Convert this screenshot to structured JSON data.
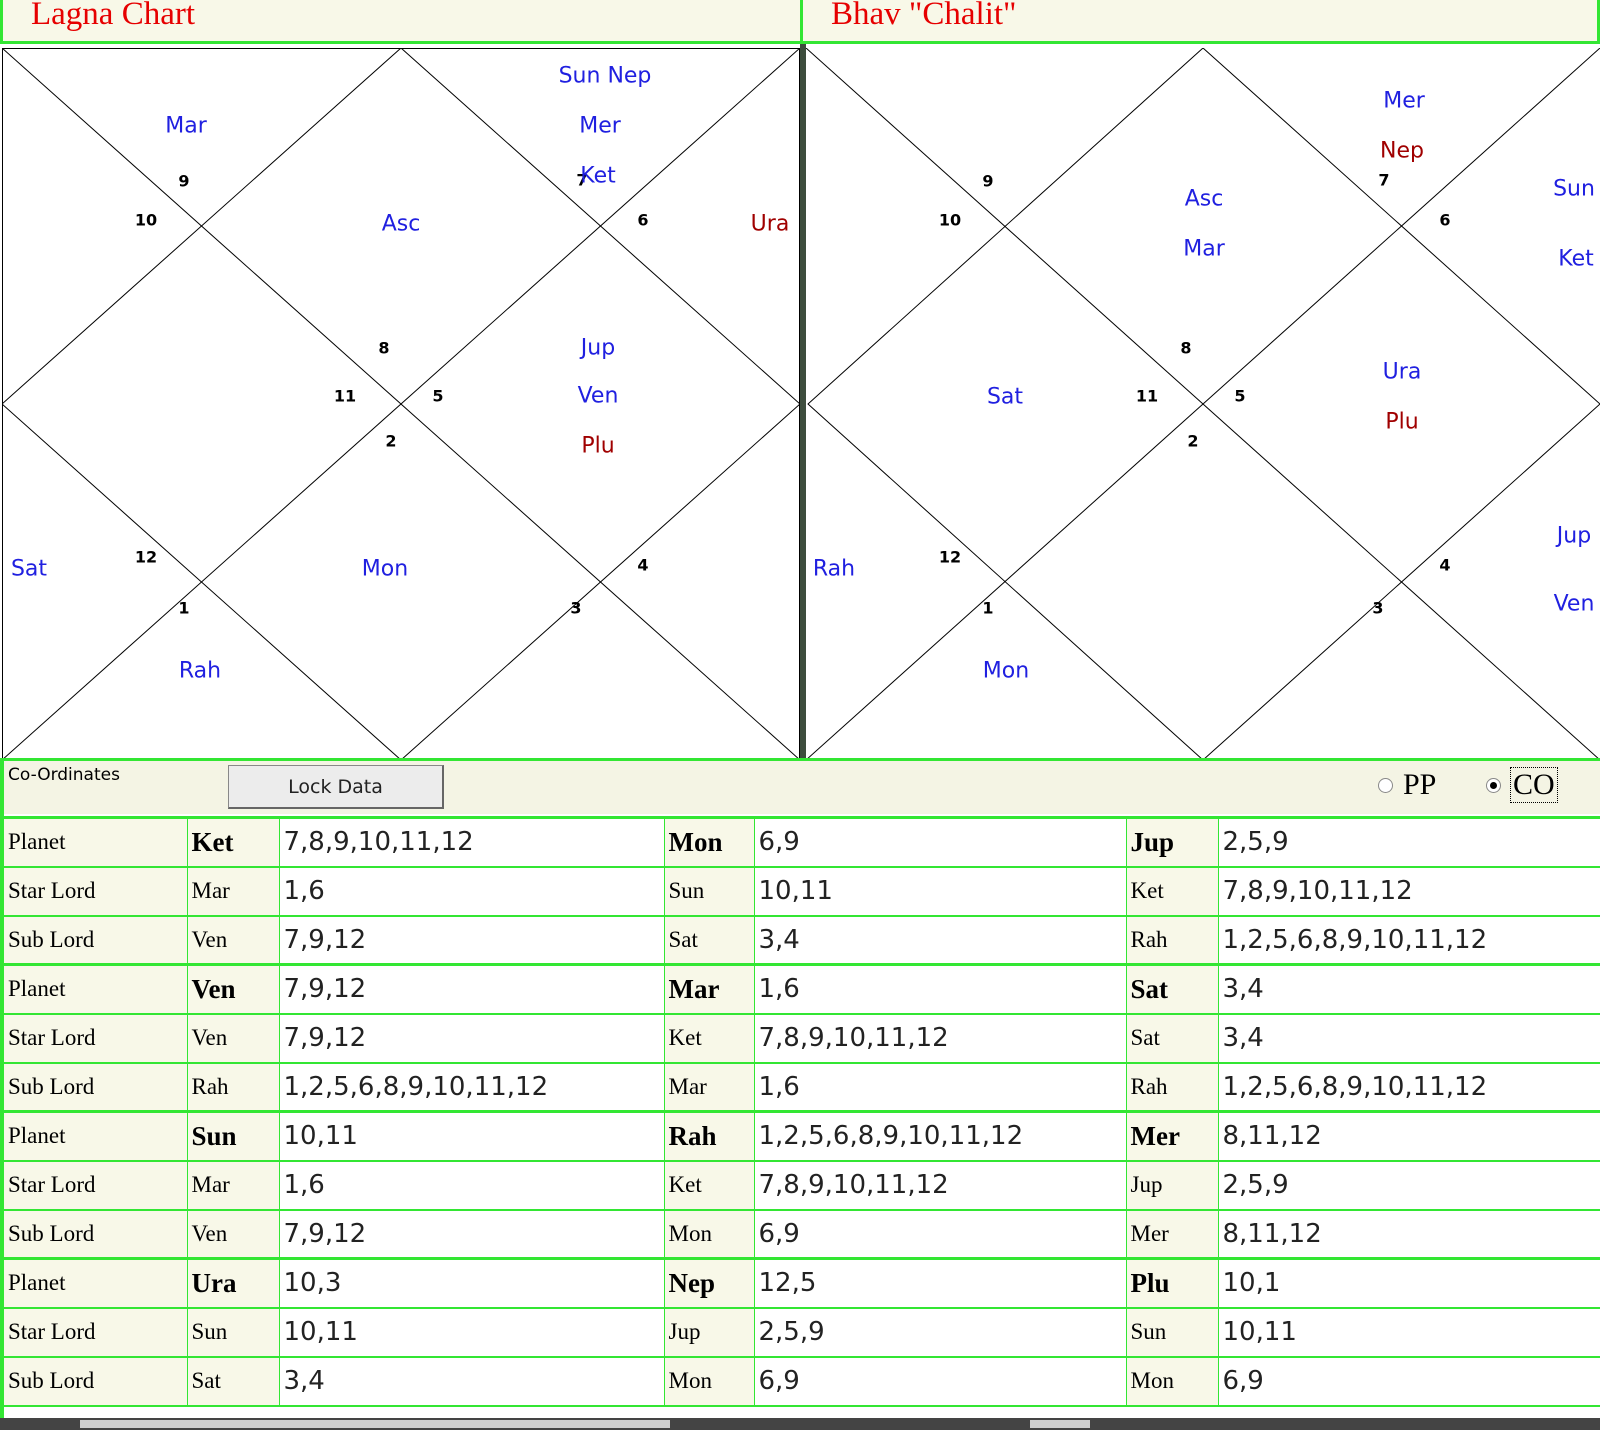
{
  "lagna": {
    "title": "Lagna Chart",
    "house_numbers": [
      "1",
      "2",
      "3",
      "4",
      "5",
      "6",
      "7",
      "8",
      "9",
      "10",
      "11",
      "12"
    ],
    "planets": [
      {
        "label": "Sun Nep",
        "color": "#2020e0"
      },
      {
        "label": "Mer",
        "color": "#2020e0"
      },
      {
        "label": "Ket",
        "color": "#2020e0"
      },
      {
        "label": "Mar",
        "color": "#2020e0"
      },
      {
        "label": "Asc",
        "color": "#2020e0"
      },
      {
        "label": "Ura",
        "color": "#a00000"
      },
      {
        "label": "Jup",
        "color": "#2020e0"
      },
      {
        "label": "Ven",
        "color": "#2020e0"
      },
      {
        "label": "Plu",
        "color": "#a00000"
      },
      {
        "label": "Sat",
        "color": "#2020e0"
      },
      {
        "label": "Mon",
        "color": "#2020e0"
      },
      {
        "label": "Rah",
        "color": "#2020e0"
      }
    ]
  },
  "chalit": {
    "title": "Bhav \"Chalit\"",
    "house_numbers": [
      "1",
      "2",
      "3",
      "4",
      "5",
      "6",
      "7",
      "8",
      "9",
      "10",
      "11",
      "12"
    ],
    "planets": [
      {
        "label": "Mer",
        "color": "#2020e0"
      },
      {
        "label": "Nep",
        "color": "#a00000"
      },
      {
        "label": "Asc",
        "color": "#2020e0"
      },
      {
        "label": "Mar",
        "color": "#2020e0"
      },
      {
        "label": "Sun",
        "color": "#2020e0"
      },
      {
        "label": "Ket",
        "color": "#2020e0"
      },
      {
        "label": "Sat",
        "color": "#2020e0"
      },
      {
        "label": "Ura",
        "color": "#2020e0"
      },
      {
        "label": "Plu",
        "color": "#a00000"
      },
      {
        "label": "Rah",
        "color": "#2020e0"
      },
      {
        "label": "Mon",
        "color": "#2020e0"
      },
      {
        "label": "Jup",
        "color": "#2020e0"
      },
      {
        "label": "Ven",
        "color": "#2020e0"
      }
    ]
  },
  "toolbar": {
    "coord_label": "Co-Ordinates",
    "lock_label": "Lock Data",
    "radio_pp": "PP",
    "radio_co": "CO",
    "selected": "CO"
  },
  "grid": {
    "row_labels": [
      "Planet",
      "Star Lord",
      "Sub Lord"
    ],
    "groups": [
      [
        {
          "planet": "Ket",
          "planet_val": "7,8,9,10,11,12",
          "star": "Mar",
          "star_val": "1,6",
          "sub": "Ven",
          "sub_val": "7,9,12"
        },
        {
          "planet": "Mon",
          "planet_val": "6,9",
          "star": "Sun",
          "star_val": "10,11",
          "sub": "Sat",
          "sub_val": "3,4"
        },
        {
          "planet": "Jup",
          "planet_val": "2,5,9",
          "star": "Ket",
          "star_val": "7,8,9,10,11,12",
          "sub": "Rah",
          "sub_val": "1,2,5,6,8,9,10,11,12"
        }
      ],
      [
        {
          "planet": "Ven",
          "planet_val": "7,9,12",
          "star": "Ven",
          "star_val": "7,9,12",
          "sub": "Rah",
          "sub_val": "1,2,5,6,8,9,10,11,12"
        },
        {
          "planet": "Mar",
          "planet_val": "1,6",
          "star": "Ket",
          "star_val": "7,8,9,10,11,12",
          "sub": "Mar",
          "sub_val": "1,6"
        },
        {
          "planet": "Sat",
          "planet_val": "3,4",
          "star": "Sat",
          "star_val": "3,4",
          "sub": "Rah",
          "sub_val": "1,2,5,6,8,9,10,11,12"
        }
      ],
      [
        {
          "planet": "Sun",
          "planet_val": "10,11",
          "star": "Mar",
          "star_val": "1,6",
          "sub": "Ven",
          "sub_val": "7,9,12"
        },
        {
          "planet": "Rah",
          "planet_val": "1,2,5,6,8,9,10,11,12",
          "star": "Ket",
          "star_val": "7,8,9,10,11,12",
          "sub": "Mon",
          "sub_val": "6,9"
        },
        {
          "planet": "Mer",
          "planet_val": "8,11,12",
          "star": "Jup",
          "star_val": "2,5,9",
          "sub": "Mer",
          "sub_val": "8,11,12"
        }
      ],
      [
        {
          "planet": "Ura",
          "planet_val": "10,3",
          "star": "Sun",
          "star_val": "10,11",
          "sub": "Sat",
          "sub_val": "3,4"
        },
        {
          "planet": "Nep",
          "planet_val": "12,5",
          "star": "Jup",
          "star_val": "2,5,9",
          "sub": "Mon",
          "sub_val": "6,9"
        },
        {
          "planet": "Plu",
          "planet_val": "10,1",
          "star": "Sun",
          "star_val": "10,11",
          "sub": "Mon",
          "sub_val": "6,9"
        }
      ]
    ]
  }
}
